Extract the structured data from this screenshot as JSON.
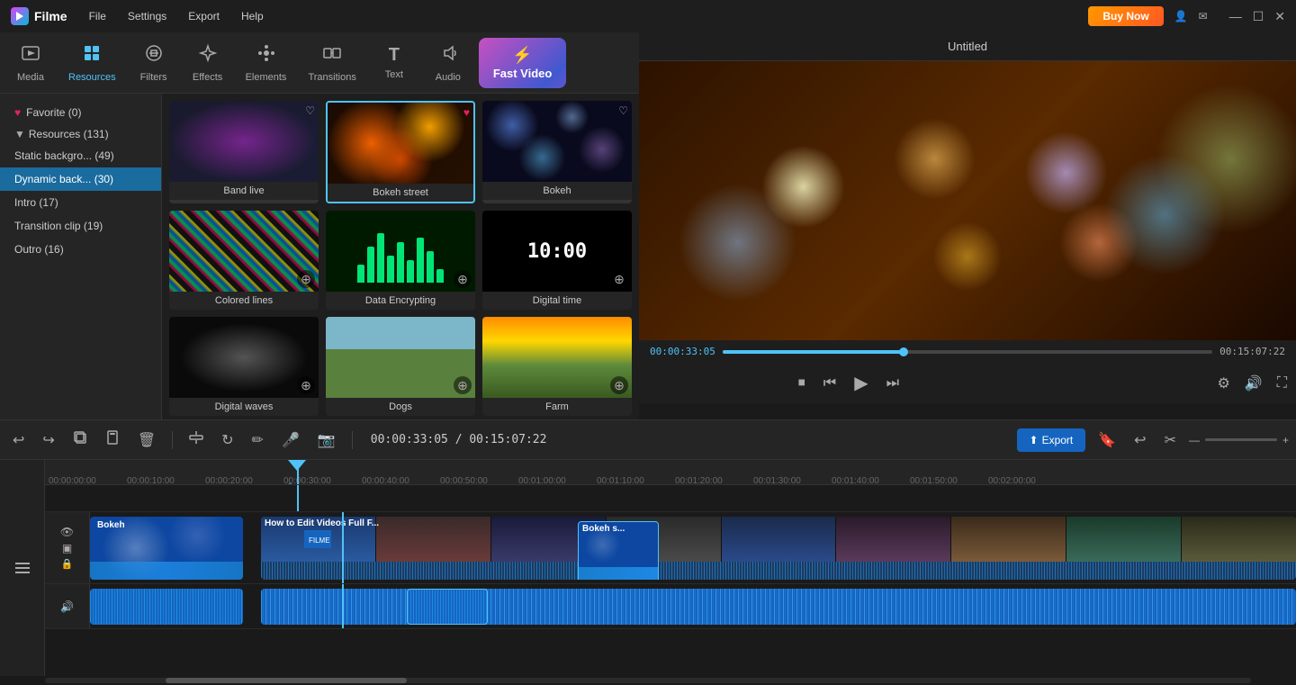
{
  "app": {
    "name": "Filme",
    "title": "Untitled"
  },
  "titlebar": {
    "menu": [
      "File",
      "Settings",
      "Export",
      "Help"
    ],
    "buy_now": "Buy Now",
    "window_controls": [
      "—",
      "☐",
      "✕"
    ]
  },
  "nav": {
    "items": [
      {
        "id": "media",
        "label": "Media",
        "icon": "🎬"
      },
      {
        "id": "resources",
        "label": "Resources",
        "icon": "📦"
      },
      {
        "id": "filters",
        "label": "Filters",
        "icon": "🎨"
      },
      {
        "id": "effects",
        "label": "Effects",
        "icon": "✨"
      },
      {
        "id": "elements",
        "label": "Elements",
        "icon": "🔷"
      },
      {
        "id": "transitions",
        "label": "Transitions",
        "icon": "↔"
      },
      {
        "id": "text",
        "label": "Text",
        "icon": "T"
      },
      {
        "id": "audio",
        "label": "Audio",
        "icon": "🎵"
      }
    ],
    "fast_video": "Fast Video",
    "active": "resources"
  },
  "sidebar": {
    "favorite": "Favorite (0)",
    "resources_section": "Resources (131)",
    "items": [
      {
        "id": "static",
        "label": "Static backgro... (49)"
      },
      {
        "id": "dynamic",
        "label": "Dynamic back... (30)",
        "active": true
      },
      {
        "id": "intro",
        "label": "Intro (17)"
      },
      {
        "id": "transition_clip",
        "label": "Transition clip (19)"
      },
      {
        "id": "outro",
        "label": "Outro (16)"
      }
    ]
  },
  "grid": {
    "items": [
      {
        "id": "band-live",
        "label": "Band live",
        "type": "band-live",
        "heart": false,
        "action": "add"
      },
      {
        "id": "bokeh-street",
        "label": "Bokeh street",
        "type": "bokeh-street",
        "heart": true,
        "action": "add",
        "selected": true
      },
      {
        "id": "bokeh",
        "label": "Bokeh",
        "type": "bokeh",
        "heart": false,
        "action": "add"
      },
      {
        "id": "colored-lines",
        "label": "Colored lines",
        "type": "colored-lines",
        "heart": false,
        "action": "download"
      },
      {
        "id": "data-encrypting",
        "label": "Data Encrypting",
        "type": "data-encrypt",
        "heart": false,
        "action": "download"
      },
      {
        "id": "digital-time",
        "label": "Digital time",
        "type": "digital-time",
        "heart": false,
        "action": "download"
      },
      {
        "id": "digital-waves",
        "label": "Digital waves",
        "type": "digital-waves",
        "heart": false,
        "action": "download"
      },
      {
        "id": "dogs",
        "label": "Dogs",
        "type": "dogs",
        "heart": false,
        "action": "download"
      },
      {
        "id": "farm",
        "label": "Farm",
        "type": "farm",
        "heart": false,
        "action": "download"
      }
    ]
  },
  "preview": {
    "title": "Untitled",
    "current_time": "00:00:33:05",
    "end_time": "00:15:07:22",
    "progress_pct": 37,
    "full_time_display": "00:00:33:05 / 00:15:07:22"
  },
  "toolbar": {
    "export_label": "Export",
    "time_display": "00:00:33:05 / 00:15:07:22"
  },
  "timeline": {
    "ruler_marks": [
      "00:00:00:00",
      "00:00:10:00",
      "00:00:20:00",
      "00:00:30:00",
      "00:00:40:00",
      "00:00:50:00",
      "00:01:00:00",
      "00:01:10:00",
      "00:01:20:00",
      "00:01:30:00",
      "00:01:40:00",
      "00:01:50:00",
      "00:02:00:00"
    ],
    "tracks": [
      {
        "clips": [
          {
            "id": "bokeh-clip",
            "label": "Bokeh",
            "start": 0,
            "width": 170
          },
          {
            "id": "how-to-edit",
            "label": "How to Edit Videos Full F...",
            "start": 190,
            "wide": true
          },
          {
            "id": "bokeh-small",
            "label": "Bokeh s...",
            "start": 352,
            "width": 90
          }
        ]
      }
    ]
  }
}
